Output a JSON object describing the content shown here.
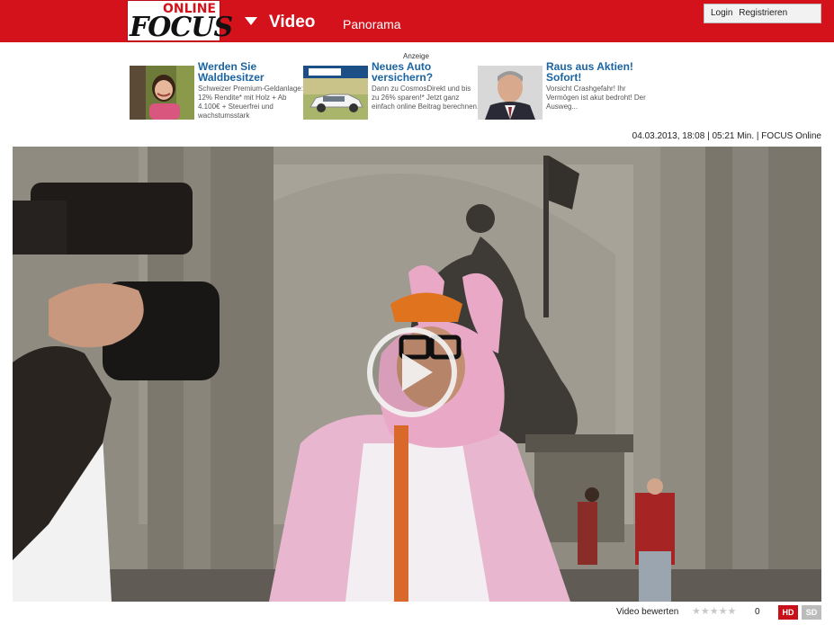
{
  "header": {
    "logo_online": "ONLINE",
    "logo_focus": "FOCUS",
    "nav_video": "Video",
    "nav_panorama": "Panorama",
    "login": "Login",
    "register": "Registrieren",
    "background_color": "#d4121b"
  },
  "ads": {
    "label": "Anzeige",
    "items": [
      {
        "title": "Werden Sie Waldbesitzer",
        "body": "Schweizer Premium-Geldanlage: 12% Rendite* mit Holz + Ab 4.100€ + Steuerfrei und wachstumsstark",
        "image": "girl-tree-photo"
      },
      {
        "title": "Neues Auto versichern?",
        "body": "Dann zu CosmosDirekt und bis zu 26% sparen!* Jetzt ganz einfach online Beitrag berechnen.",
        "image": "white-car-photo"
      },
      {
        "title": "Raus aus Aktien! Sofort!",
        "body": "Vorsicht Crashgefahr! Ihr Vermögen ist akut bedroht! Der Ausweg...",
        "image": "man-portrait-photo"
      }
    ]
  },
  "video_meta": "04.03.2013, 18:08 | 05:21 Min. | FOCUS Online",
  "player": {
    "play_icon": "play-icon"
  },
  "footer": {
    "rate_label": "Video bewerten",
    "stars": "★★★★★",
    "rating_count": "0",
    "hd_label": "HD",
    "sd_label": "SD",
    "hd_color": "#c81018"
  }
}
